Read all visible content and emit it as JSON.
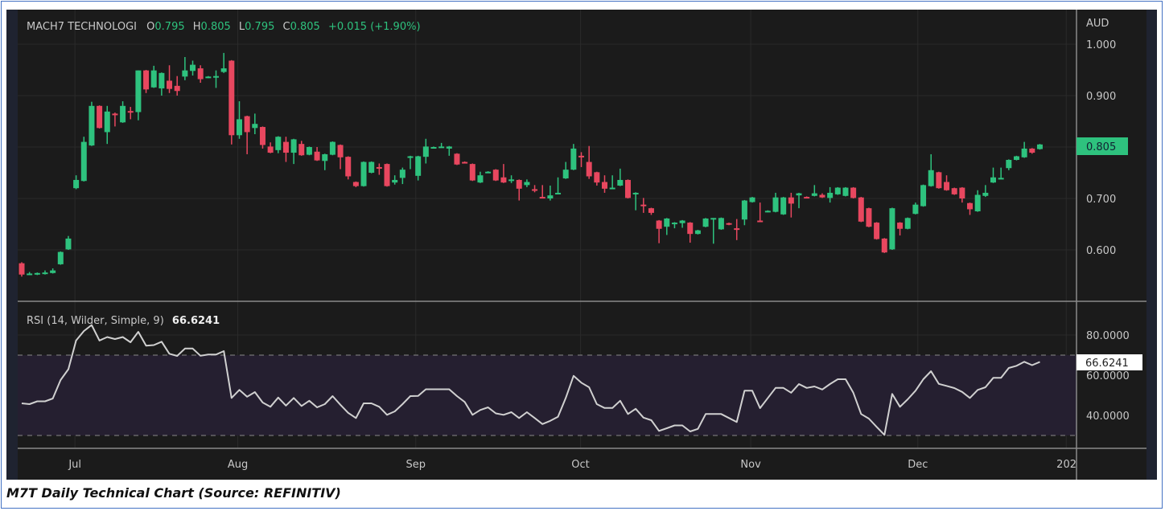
{
  "legend": {
    "name": "MACH7 TECHNOLOGI",
    "o_label": "O",
    "o_value": "0.795",
    "h_label": "H",
    "h_value": "0.805",
    "l_label": "L",
    "l_value": "0.795",
    "c_label": "C",
    "c_value": "0.805",
    "change": "+0.015 (+1.90%)"
  },
  "currency": "AUD",
  "last_price_label": "0.805",
  "rsi_legend": {
    "name": "RSI (14, Wilder, Simple, 9)",
    "value": "66.6241"
  },
  "rsi_last_label": "66.6241",
  "caption": "M7T Daily Technical Chart (Source: REFINITIV)",
  "colors": {
    "up": "#2ec27e",
    "down": "#e8475f",
    "background": "#1b1b1b",
    "rsi_line": "#d0d0d0",
    "rsi_band": "#251f30"
  },
  "chart_data": [
    {
      "type": "candlestick",
      "title": "MACH7 TECHNOLOGI",
      "ylabel": "AUD",
      "ylim": [
        0.52,
        1.05
      ],
      "yticks": [
        "1.000",
        "0.900",
        "0.700",
        "0.600"
      ],
      "ytick_values": [
        1.0,
        0.9,
        0.7,
        0.6
      ],
      "xticks": [
        "Jul",
        "Aug",
        "Sep",
        "Oct",
        "Nov",
        "Dec",
        "202"
      ],
      "xtick_index": [
        6.85,
        27.8,
        50.7,
        71.9,
        93.8,
        115.3,
        134.4
      ],
      "grid": true,
      "candles_ohlc": [
        [
          0.574,
          0.576,
          0.548,
          0.552
        ],
        [
          0.552,
          0.557,
          0.551,
          0.554
        ],
        [
          0.552,
          0.556,
          0.551,
          0.555
        ],
        [
          0.553,
          0.56,
          0.552,
          0.556
        ],
        [
          0.555,
          0.564,
          0.554,
          0.56
        ],
        [
          0.572,
          0.597,
          0.571,
          0.596
        ],
        [
          0.601,
          0.627,
          0.6,
          0.622
        ],
        [
          0.72,
          0.745,
          0.718,
          0.736
        ],
        [
          0.734,
          0.82,
          0.733,
          0.81
        ],
        [
          0.803,
          0.888,
          0.802,
          0.88
        ],
        [
          0.88,
          0.881,
          0.836,
          0.837
        ],
        [
          0.829,
          0.88,
          0.806,
          0.869
        ],
        [
          0.865,
          0.867,
          0.84,
          0.862
        ],
        [
          0.848,
          0.889,
          0.847,
          0.88
        ],
        [
          0.87,
          0.878,
          0.854,
          0.868
        ],
        [
          0.868,
          0.949,
          0.852,
          0.949
        ],
        [
          0.949,
          0.95,
          0.905,
          0.912
        ],
        [
          0.916,
          0.958,
          0.915,
          0.949
        ],
        [
          0.914,
          0.945,
          0.9,
          0.944
        ],
        [
          0.929,
          0.959,
          0.905,
          0.913
        ],
        [
          0.919,
          0.938,
          0.9,
          0.909
        ],
        [
          0.937,
          0.975,
          0.93,
          0.949
        ],
        [
          0.948,
          0.968,
          0.939,
          0.96
        ],
        [
          0.953,
          0.959,
          0.925,
          0.932
        ],
        [
          0.935,
          0.938,
          0.934,
          0.937
        ],
        [
          0.937,
          0.949,
          0.915,
          0.938
        ],
        [
          0.946,
          0.983,
          0.944,
          0.953
        ],
        [
          0.968,
          0.969,
          0.805,
          0.823
        ],
        [
          0.823,
          0.889,
          0.816,
          0.854
        ],
        [
          0.86,
          0.861,
          0.786,
          0.829
        ],
        [
          0.837,
          0.865,
          0.825,
          0.845
        ],
        [
          0.839,
          0.84,
          0.797,
          0.804
        ],
        [
          0.801,
          0.809,
          0.788,
          0.789
        ],
        [
          0.794,
          0.821,
          0.788,
          0.82
        ],
        [
          0.81,
          0.82,
          0.771,
          0.789
        ],
        [
          0.789,
          0.816,
          0.767,
          0.815
        ],
        [
          0.806,
          0.812,
          0.783,
          0.784
        ],
        [
          0.785,
          0.801,
          0.784,
          0.8
        ],
        [
          0.791,
          0.8,
          0.773,
          0.774
        ],
        [
          0.773,
          0.787,
          0.755,
          0.786
        ],
        [
          0.785,
          0.811,
          0.784,
          0.81
        ],
        [
          0.804,
          0.805,
          0.757,
          0.78
        ],
        [
          0.781,
          0.782,
          0.737,
          0.743
        ],
        [
          0.732,
          0.733,
          0.722,
          0.724
        ],
        [
          0.724,
          0.772,
          0.723,
          0.771
        ],
        [
          0.75,
          0.772,
          0.749,
          0.771
        ],
        [
          0.761,
          0.768,
          0.746,
          0.76
        ],
        [
          0.767,
          0.768,
          0.723,
          0.724
        ],
        [
          0.731,
          0.745,
          0.727,
          0.736
        ],
        [
          0.74,
          0.76,
          0.728,
          0.756
        ],
        [
          0.781,
          0.783,
          0.757,
          0.782
        ],
        [
          0.744,
          0.783,
          0.735,
          0.782
        ],
        [
          0.781,
          0.816,
          0.768,
          0.801
        ],
        [
          0.799,
          0.801,
          0.798,
          0.8
        ],
        [
          0.8,
          0.808,
          0.799,
          0.801
        ],
        [
          0.797,
          0.802,
          0.783,
          0.801
        ],
        [
          0.787,
          0.788,
          0.765,
          0.766
        ],
        [
          0.771,
          0.772,
          0.769,
          0.77
        ],
        [
          0.767,
          0.768,
          0.734,
          0.735
        ],
        [
          0.731,
          0.752,
          0.73,
          0.745
        ],
        [
          0.751,
          0.753,
          0.75,
          0.752
        ],
        [
          0.756,
          0.757,
          0.734,
          0.735
        ],
        [
          0.741,
          0.767,
          0.73,
          0.731
        ],
        [
          0.736,
          0.745,
          0.73,
          0.737
        ],
        [
          0.736,
          0.737,
          0.696,
          0.719
        ],
        [
          0.726,
          0.737,
          0.722,
          0.732
        ],
        [
          0.718,
          0.726,
          0.712,
          0.717
        ],
        [
          0.703,
          0.726,
          0.702,
          0.702
        ],
        [
          0.7,
          0.725,
          0.696,
          0.706
        ],
        [
          0.71,
          0.741,
          0.709,
          0.711
        ],
        [
          0.739,
          0.771,
          0.738,
          0.756
        ],
        [
          0.756,
          0.806,
          0.755,
          0.797
        ],
        [
          0.783,
          0.79,
          0.761,
          0.782
        ],
        [
          0.771,
          0.802,
          0.738,
          0.743
        ],
        [
          0.751,
          0.752,
          0.725,
          0.731
        ],
        [
          0.732,
          0.745,
          0.711,
          0.719
        ],
        [
          0.72,
          0.745,
          0.719,
          0.721
        ],
        [
          0.725,
          0.758,
          0.724,
          0.736
        ],
        [
          0.736,
          0.737,
          0.7,
          0.701
        ],
        [
          0.71,
          0.712,
          0.677,
          0.711
        ],
        [
          0.688,
          0.701,
          0.672,
          0.687
        ],
        [
          0.681,
          0.682,
          0.668,
          0.672
        ],
        [
          0.657,
          0.658,
          0.613,
          0.641
        ],
        [
          0.645,
          0.662,
          0.629,
          0.661
        ],
        [
          0.652,
          0.654,
          0.642,
          0.653
        ],
        [
          0.652,
          0.658,
          0.643,
          0.657
        ],
        [
          0.653,
          0.654,
          0.614,
          0.631
        ],
        [
          0.631,
          0.639,
          0.63,
          0.638
        ],
        [
          0.645,
          0.662,
          0.644,
          0.661
        ],
        [
          0.66,
          0.662,
          0.612,
          0.662
        ],
        [
          0.64,
          0.663,
          0.639,
          0.662
        ],
        [
          0.652,
          0.653,
          0.648,
          0.651
        ],
        [
          0.642,
          0.66,
          0.619,
          0.641
        ],
        [
          0.659,
          0.697,
          0.648,
          0.696
        ],
        [
          0.693,
          0.703,
          0.692,
          0.702
        ],
        [
          0.657,
          0.692,
          0.655,
          0.656
        ],
        [
          0.675,
          0.677,
          0.673,
          0.676
        ],
        [
          0.674,
          0.711,
          0.673,
          0.702
        ],
        [
          0.669,
          0.703,
          0.668,
          0.702
        ],
        [
          0.702,
          0.711,
          0.663,
          0.69
        ],
        [
          0.706,
          0.711,
          0.681,
          0.71
        ],
        [
          0.703,
          0.704,
          0.701,
          0.702
        ],
        [
          0.705,
          0.726,
          0.704,
          0.71
        ],
        [
          0.707,
          0.71,
          0.701,
          0.702
        ],
        [
          0.701,
          0.722,
          0.692,
          0.711
        ],
        [
          0.708,
          0.722,
          0.707,
          0.721
        ],
        [
          0.705,
          0.722,
          0.704,
          0.721
        ],
        [
          0.721,
          0.722,
          0.7,
          0.701
        ],
        [
          0.702,
          0.703,
          0.654,
          0.655
        ],
        [
          0.681,
          0.682,
          0.644,
          0.645
        ],
        [
          0.653,
          0.654,
          0.62,
          0.621
        ],
        [
          0.622,
          0.623,
          0.594,
          0.595
        ],
        [
          0.601,
          0.682,
          0.6,
          0.681
        ],
        [
          0.653,
          0.654,
          0.628,
          0.641
        ],
        [
          0.641,
          0.663,
          0.64,
          0.662
        ],
        [
          0.67,
          0.692,
          0.669,
          0.688
        ],
        [
          0.685,
          0.727,
          0.684,
          0.726
        ],
        [
          0.724,
          0.786,
          0.723,
          0.755
        ],
        [
          0.751,
          0.752,
          0.719,
          0.72
        ],
        [
          0.732,
          0.745,
          0.715,
          0.716
        ],
        [
          0.72,
          0.721,
          0.707,
          0.708
        ],
        [
          0.721,
          0.722,
          0.692,
          0.7
        ],
        [
          0.691,
          0.692,
          0.668,
          0.679
        ],
        [
          0.675,
          0.716,
          0.674,
          0.707
        ],
        [
          0.705,
          0.726,
          0.703,
          0.711
        ],
        [
          0.731,
          0.76,
          0.73,
          0.741
        ],
        [
          0.739,
          0.76,
          0.738,
          0.74
        ],
        [
          0.759,
          0.776,
          0.755,
          0.775
        ],
        [
          0.775,
          0.783,
          0.774,
          0.782
        ],
        [
          0.78,
          0.81,
          0.779,
          0.797
        ],
        [
          0.797,
          0.798,
          0.787,
          0.789
        ],
        [
          0.796,
          0.806,
          0.795,
          0.805
        ]
      ]
    },
    {
      "type": "line",
      "title": "RSI (14, Wilder, Simple, 9)",
      "ylim": [
        25,
        92
      ],
      "yticks": [
        "80.0000",
        "60.0000",
        "40.0000"
      ],
      "ytick_values": [
        80,
        60,
        40
      ],
      "bands": {
        "upper": 70,
        "lower": 30
      },
      "values": [
        46,
        45.6,
        47,
        47,
        48.4,
        57.6,
        63,
        77.3,
        82,
        85,
        77.3,
        79,
        78,
        79,
        76.4,
        81.6,
        74.7,
        75,
        76.7,
        70.7,
        69.6,
        73.3,
        73.3,
        69.7,
        70.3,
        70.3,
        72,
        48.7,
        52.7,
        49.3,
        51.6,
        46.4,
        44.3,
        48.9,
        44.9,
        48.7,
        44.7,
        47.3,
        44,
        45.6,
        49.6,
        45.3,
        41.3,
        38.7,
        46,
        46,
        44.3,
        40.3,
        42,
        45.6,
        49.6,
        49.7,
        53,
        53,
        53,
        53,
        49.6,
        46.7,
        40.3,
        42.7,
        44,
        41,
        40.3,
        41.6,
        38.7,
        41.6,
        38.7,
        35.7,
        37.3,
        39.3,
        48.7,
        59.7,
        56.3,
        54,
        45.6,
        43.7,
        43.7,
        47.3,
        40.7,
        43.3,
        38.9,
        37.6,
        32.3,
        33.6,
        35,
        35,
        32,
        33.3,
        40.7,
        40.7,
        40.7,
        38.7,
        36.7,
        52.3,
        52.3,
        43.6,
        48.7,
        53.7,
        53.7,
        51.3,
        55.6,
        53.7,
        54.4,
        52.9,
        55.6,
        58,
        58,
        51.3,
        40.7,
        38.4,
        34.3,
        30.3,
        50.7,
        44.3,
        48,
        52.3,
        58,
        62,
        55.7,
        54.7,
        53.6,
        51.7,
        48.7,
        52.7,
        54,
        58.7,
        58.7,
        63.6,
        64.7,
        66.7,
        65,
        66.62
      ]
    }
  ]
}
